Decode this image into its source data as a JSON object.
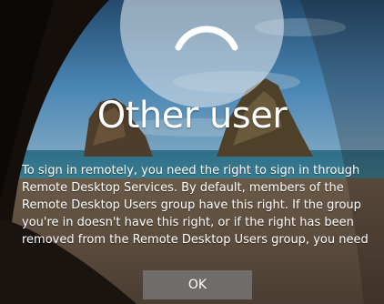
{
  "login": {
    "username": "Other user",
    "message": "To sign in remotely, you need the right to sign in through Remote Desktop Services. By default, members of the Remote Desktop Users group have this right. If the group you're in doesn't have this right, or if the right has been removed from the Remote Desktop Users group, you need",
    "ok_label": "OK"
  },
  "icons": {
    "avatar": "user-avatar-icon"
  },
  "colors": {
    "text": "#ffffff",
    "button": "#787878",
    "sky": "#3a6f9c",
    "sea": "#2c6b86"
  }
}
